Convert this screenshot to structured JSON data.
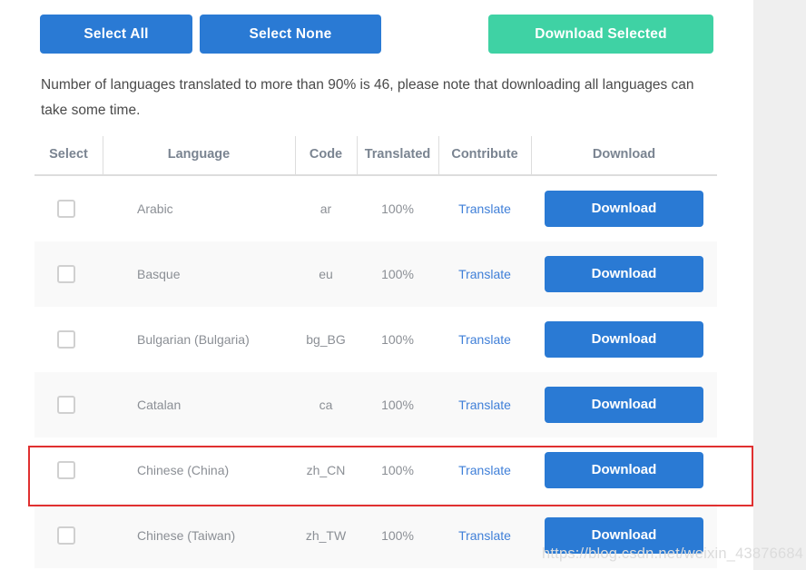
{
  "toolbar": {
    "select_all_label": "Select All",
    "select_none_label": "Select None",
    "download_selected_label": "Download Selected",
    "primary_color": "#2a7ad4",
    "success_color": "#3fd2a4"
  },
  "note": {
    "text": "Number of languages translated to more than 90% is 46, please note that downloading all languages can take some time.",
    "threshold_percent": "90%",
    "language_count": "46"
  },
  "table": {
    "headers": {
      "select": "Select",
      "language": "Language",
      "code": "Code",
      "translated": "Translated",
      "contribute": "Contribute",
      "download": "Download"
    },
    "row_action_label": "Download",
    "contribute_link_label": "Translate",
    "rows": [
      {
        "language": "Arabic",
        "code": "ar",
        "translated": "100%",
        "contribute": "Translate",
        "download": "Download"
      },
      {
        "language": "Basque",
        "code": "eu",
        "translated": "100%",
        "contribute": "Translate",
        "download": "Download"
      },
      {
        "language": "Bulgarian (Bulgaria)",
        "code": "bg_BG",
        "translated": "100%",
        "contribute": "Translate",
        "download": "Download"
      },
      {
        "language": "Catalan",
        "code": "ca",
        "translated": "100%",
        "contribute": "Translate",
        "download": "Download"
      },
      {
        "language": "Chinese (China)",
        "code": "zh_CN",
        "translated": "100%",
        "contribute": "Translate",
        "download": "Download"
      },
      {
        "language": "Chinese (Taiwan)",
        "code": "zh_TW",
        "translated": "100%",
        "contribute": "Translate",
        "download": "Download"
      }
    ]
  },
  "annotation": {
    "highlight_color": "#e03030",
    "highlighted_row_language": "Chinese (China)"
  },
  "watermark": {
    "text": "https://blog.csdn.net/weixin_43876684"
  }
}
